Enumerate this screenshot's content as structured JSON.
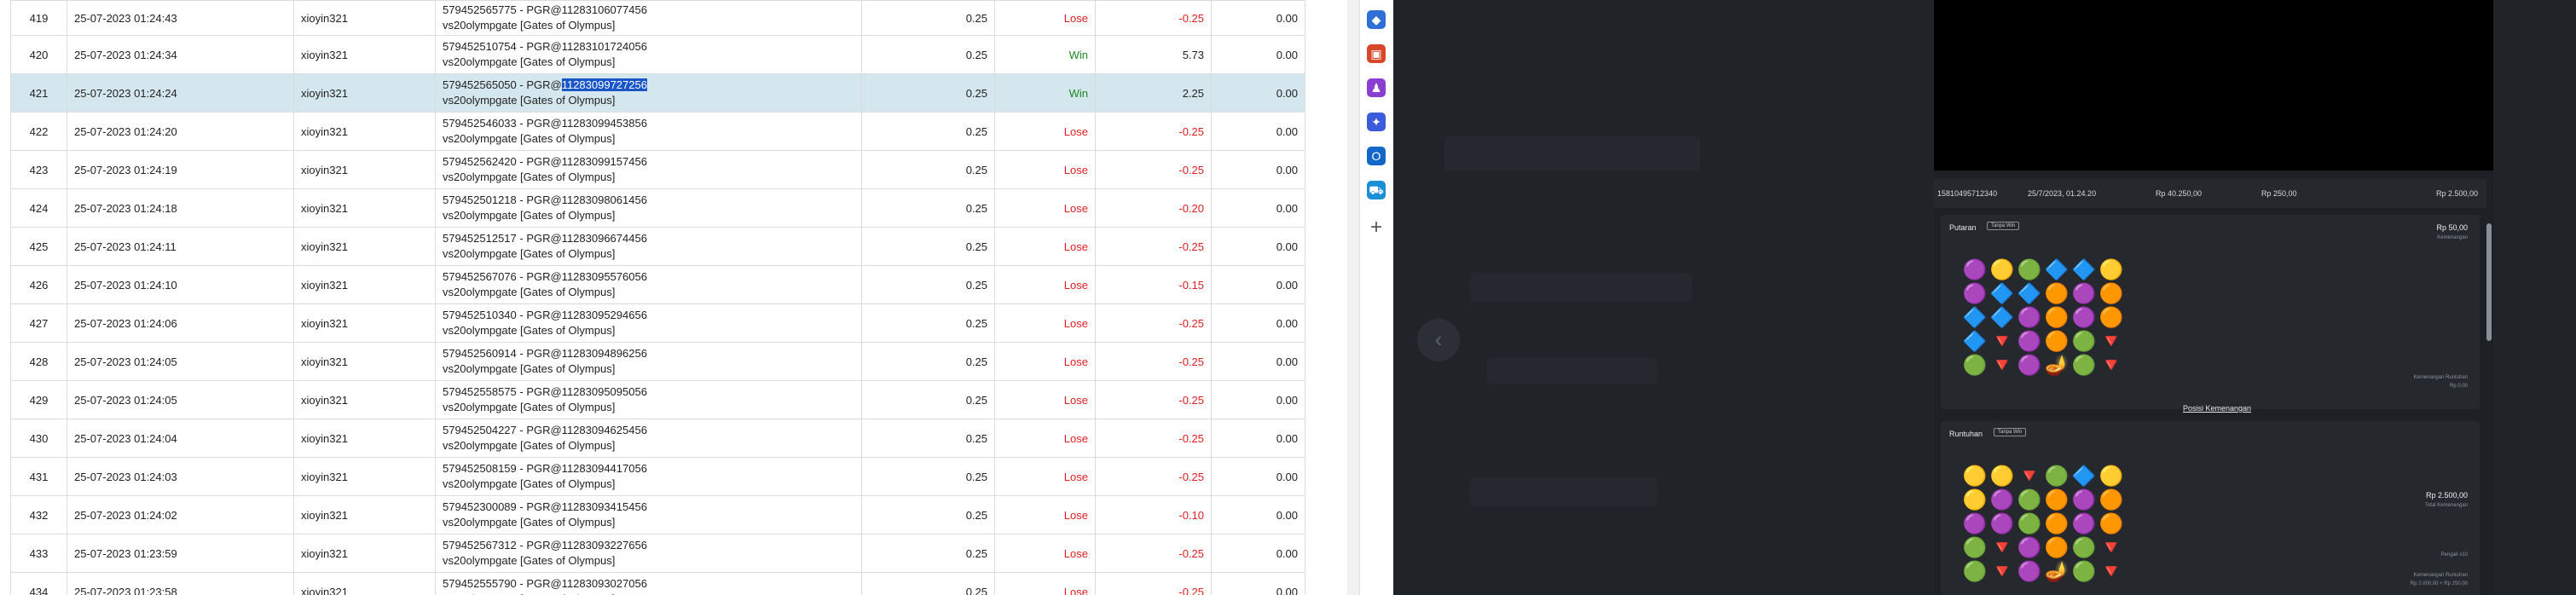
{
  "bet_table": {
    "rows": [
      {
        "no": "419",
        "date": "25-07-2023 01:24:43",
        "user": "xioyin321",
        "ticket": "579452565775 - PGR@11283106077456",
        "game": "vs20olympgate [Gates of Olympus]",
        "bet": "0.25",
        "result": "Lose",
        "winlose": "-0.25",
        "comm": "0.00"
      },
      {
        "no": "420",
        "date": "25-07-2023 01:24:34",
        "user": "xioyin321",
        "ticket": "579452510754 - PGR@11283101724056",
        "game": "vs20olympgate [Gates of Olympus]",
        "bet": "0.25",
        "result": "Win",
        "winlose": "5.73",
        "comm": "0.00"
      },
      {
        "no": "421",
        "date": "25-07-2023 01:24:24",
        "user": "xioyin321",
        "ticket": "579452565050 - PGR@",
        "ticket_highlight": "11283099727256",
        "game": "vs20olympgate [Gates of Olympus]",
        "bet": "0.25",
        "result": "Win",
        "winlose": "2.25",
        "comm": "0.00",
        "selected": true
      },
      {
        "no": "422",
        "date": "25-07-2023 01:24:20",
        "user": "xioyin321",
        "ticket": "579452546033 - PGR@11283099453856",
        "game": "vs20olympgate [Gates of Olympus]",
        "bet": "0.25",
        "result": "Lose",
        "winlose": "-0.25",
        "comm": "0.00"
      },
      {
        "no": "423",
        "date": "25-07-2023 01:24:19",
        "user": "xioyin321",
        "ticket": "579452562420 - PGR@11283099157456",
        "game": "vs20olympgate [Gates of Olympus]",
        "bet": "0.25",
        "result": "Lose",
        "winlose": "-0.25",
        "comm": "0.00"
      },
      {
        "no": "424",
        "date": "25-07-2023 01:24:18",
        "user": "xioyin321",
        "ticket": "579452501218 - PGR@11283098061456",
        "game": "vs20olympgate [Gates of Olympus]",
        "bet": "0.25",
        "result": "Lose",
        "winlose": "-0.20",
        "comm": "0.00"
      },
      {
        "no": "425",
        "date": "25-07-2023 01:24:11",
        "user": "xioyin321",
        "ticket": "579452512517 - PGR@11283096674456",
        "game": "vs20olympgate [Gates of Olympus]",
        "bet": "0.25",
        "result": "Lose",
        "winlose": "-0.25",
        "comm": "0.00"
      },
      {
        "no": "426",
        "date": "25-07-2023 01:24:10",
        "user": "xioyin321",
        "ticket": "579452567076 - PGR@11283095576056",
        "game": "vs20olympgate [Gates of Olympus]",
        "bet": "0.25",
        "result": "Lose",
        "winlose": "-0.15",
        "comm": "0.00"
      },
      {
        "no": "427",
        "date": "25-07-2023 01:24:06",
        "user": "xioyin321",
        "ticket": "579452510340 - PGR@11283095294656",
        "game": "vs20olympgate [Gates of Olympus]",
        "bet": "0.25",
        "result": "Lose",
        "winlose": "-0.25",
        "comm": "0.00"
      },
      {
        "no": "428",
        "date": "25-07-2023 01:24:05",
        "user": "xioyin321",
        "ticket": "579452560914 - PGR@11283094896256",
        "game": "vs20olympgate [Gates of Olympus]",
        "bet": "0.25",
        "result": "Lose",
        "winlose": "-0.25",
        "comm": "0.00"
      },
      {
        "no": "429",
        "date": "25-07-2023 01:24:05",
        "user": "xioyin321",
        "ticket": "579452558575 - PGR@11283095095056",
        "game": "vs20olympgate [Gates of Olympus]",
        "bet": "0.25",
        "result": "Lose",
        "winlose": "-0.25",
        "comm": "0.00"
      },
      {
        "no": "430",
        "date": "25-07-2023 01:24:04",
        "user": "xioyin321",
        "ticket": "579452504227 - PGR@11283094625456",
        "game": "vs20olympgate [Gates of Olympus]",
        "bet": "0.25",
        "result": "Lose",
        "winlose": "-0.25",
        "comm": "0.00"
      },
      {
        "no": "431",
        "date": "25-07-2023 01:24:03",
        "user": "xioyin321",
        "ticket": "579452508159 - PGR@11283094417056",
        "game": "vs20olympgate [Gates of Olympus]",
        "bet": "0.25",
        "result": "Lose",
        "winlose": "-0.25",
        "comm": "0.00"
      },
      {
        "no": "432",
        "date": "25-07-2023 01:24:02",
        "user": "xioyin321",
        "ticket": "579452300089 - PGR@11283093415456",
        "game": "vs20olympgate [Gates of Olympus]",
        "bet": "0.25",
        "result": "Lose",
        "winlose": "-0.10",
        "comm": "0.00"
      },
      {
        "no": "433",
        "date": "25-07-2023 01:23:59",
        "user": "xioyin321",
        "ticket": "579452567312 - PGR@11283093227656",
        "game": "vs20olympgate [Gates of Olympus]",
        "bet": "0.25",
        "result": "Lose",
        "winlose": "-0.25",
        "comm": "0.00"
      },
      {
        "no": "434",
        "date": "25-07-2023 01:23:58",
        "user": "xioyin321",
        "ticket": "579452555790 - PGR@11283093027056",
        "game": "vs20olympgate [Gates of Olympus]",
        "bet": "0.25",
        "result": "Lose",
        "winlose": "-0.25",
        "comm": "0.00"
      }
    ]
  },
  "browser_sidebar": {
    "icons": [
      {
        "name": "tag-icon",
        "glyph": "◆",
        "color": "#2f6fd6"
      },
      {
        "name": "toolbox-icon",
        "glyph": "▣",
        "color": "#d9472b"
      },
      {
        "name": "games-icon",
        "glyph": "♟",
        "color": "#8a3fd1"
      },
      {
        "name": "copilot-icon",
        "glyph": "✦",
        "color": "#3b5bdb"
      },
      {
        "name": "outlook-icon",
        "glyph": "O",
        "color": "#1466c8"
      },
      {
        "name": "shopping-icon",
        "glyph": "⛟",
        "color": "#1a8fd6"
      }
    ],
    "add_glyph": "+"
  },
  "game_window": {
    "nav_arrow": "‹",
    "summary": {
      "id": "15810495712340",
      "datetime": "25/7/2023, 01.24.20",
      "balance": "Rp 40.250,00",
      "bet": "Rp 250,00",
      "win": "Rp 2.500,00"
    },
    "spin": {
      "title": "Putaran",
      "chip": "Tanpa Win",
      "amount": "Rp 50,00",
      "amount_label": "Kemenangan",
      "side_label": "Kemenangan Runtuhan",
      "side_value": "Rp 0,00",
      "link": "Posisi Kemenangan",
      "grid": [
        [
          "🟣",
          "🟡",
          "🟢",
          "🔷",
          "🔷",
          "🟡"
        ],
        [
          "🟣",
          "🔷",
          "🔷",
          "🟠",
          "🟣",
          "🟠"
        ],
        [
          "🔷",
          "🔷",
          "🟣",
          "🟠",
          "🟣",
          "🟠"
        ],
        [
          "🔷",
          "🔻",
          "🟣",
          "🟠",
          "🟢",
          "🔻"
        ],
        [
          "🟢",
          "🔻",
          "🟣",
          "🪔",
          "🟢",
          "🔻"
        ]
      ]
    },
    "tumble": {
      "title": "Runtuhan",
      "chip": "Tanpa Win",
      "amount": "Rp 2.500,00",
      "amount_label": "Total Kemenangan",
      "side_label": "Pengali x10",
      "side_label2": "Kemenangan Runtuhan",
      "side_value": "Rp 2.000,00 + Rp 250,00",
      "grid": [
        [
          "🟡",
          "🟡",
          "🔻",
          "🟢",
          "🔷",
          "🟡"
        ],
        [
          "🟡",
          "🟣",
          "🟢",
          "🟠",
          "🟣",
          "🟠"
        ],
        [
          "🟣",
          "🟣",
          "🟢",
          "🟠",
          "🟣",
          "🟠"
        ],
        [
          "🟢",
          "🔻",
          "🟣",
          "🟠",
          "🟢",
          "🔻"
        ],
        [
          "🟢",
          "🔻",
          "🟣",
          "🪔",
          "🟢",
          "🔻"
        ]
      ]
    }
  }
}
